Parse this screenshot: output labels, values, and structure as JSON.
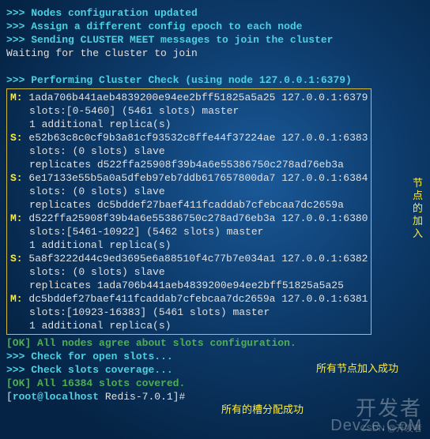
{
  "pre": [
    {
      "p": ">>> ",
      "t": "Nodes configuration updated"
    },
    {
      "p": ">>> ",
      "t": "Assign a different config epoch to each node"
    },
    {
      "p": ">>> ",
      "t": "Sending CLUSTER MEET messages to join the cluster"
    },
    {
      "p": "",
      "t": "Waiting for the cluster to join"
    },
    {
      "p": "",
      "t": ""
    },
    {
      "p": ">>> ",
      "t": "Performing Cluster Check (using node 127.0.0.1:6379)"
    }
  ],
  "nodes": [
    {
      "role": "M",
      "id": "1ada706b441aeb4839200e94ee2bff51825a5a25",
      "addr": "127.0.0.1:6379",
      "line2": "slots:[0-5460] (5461 slots) master",
      "line3": "1 additional replica(s)"
    },
    {
      "role": "S",
      "id": "e52b63c8c0cf9b3a81cf93532c8ffe44f37224ae",
      "addr": "127.0.0.1:6383",
      "line2": "slots: (0 slots) slave",
      "line3": "replicates d522ffa25908f39b4a6e55386750c278ad76eb3a"
    },
    {
      "role": "S",
      "id": "6e17133e55b5a0a5dfeb97eb7ddb617657800da7",
      "addr": "127.0.0.1:6384",
      "line2": "slots: (0 slots) slave",
      "line3": "replicates dc5bddef27baef411fcaddab7cfebcaa7dc2659a"
    },
    {
      "role": "M",
      "id": "d522ffa25908f39b4a6e55386750c278ad76eb3a",
      "addr": "127.0.0.1:6380",
      "line2": "slots:[5461-10922] (5462 slots) master",
      "line3": "1 additional replica(s)"
    },
    {
      "role": "S",
      "id": "5a8f3222d44c9ed3695e6a88510f4c77b7e034a1",
      "addr": "127.0.0.1:6382",
      "line2": "slots: (0 slots) slave",
      "line3": "replicates 1ada706b441aeb4839200e94ee2bff51825a5a25"
    },
    {
      "role": "M",
      "id": "dc5bddef27baef411fcaddab7cfebcaa7dc2659a",
      "addr": "127.0.0.1:6381",
      "line2": "slots:[10923-16383] (5461 slots) master",
      "line3": "1 additional replica(s)"
    }
  ],
  "post": [
    {
      "ok": true,
      "t": "All nodes agree about slots configuration."
    },
    {
      "p": ">>> ",
      "t": "Check for open slots..."
    },
    {
      "p": ">>> ",
      "t": "Check slots coverage..."
    },
    {
      "ok": true,
      "t": "All 16384 slots covered."
    }
  ],
  "prompt": {
    "user": "root@localhost",
    "path": "Redis-7.0.1",
    "sym": "#"
  },
  "annotations": {
    "join": "节点的加入",
    "allJoined": "所有节点加入成功",
    "slotsDone": "所有的槽分配成功"
  },
  "watermarks": {
    "big": "开发者",
    "small": "DevZe.CoM",
    "csdn": "CSDN @开发者"
  },
  "labels": {
    "ok": "[OK]"
  }
}
